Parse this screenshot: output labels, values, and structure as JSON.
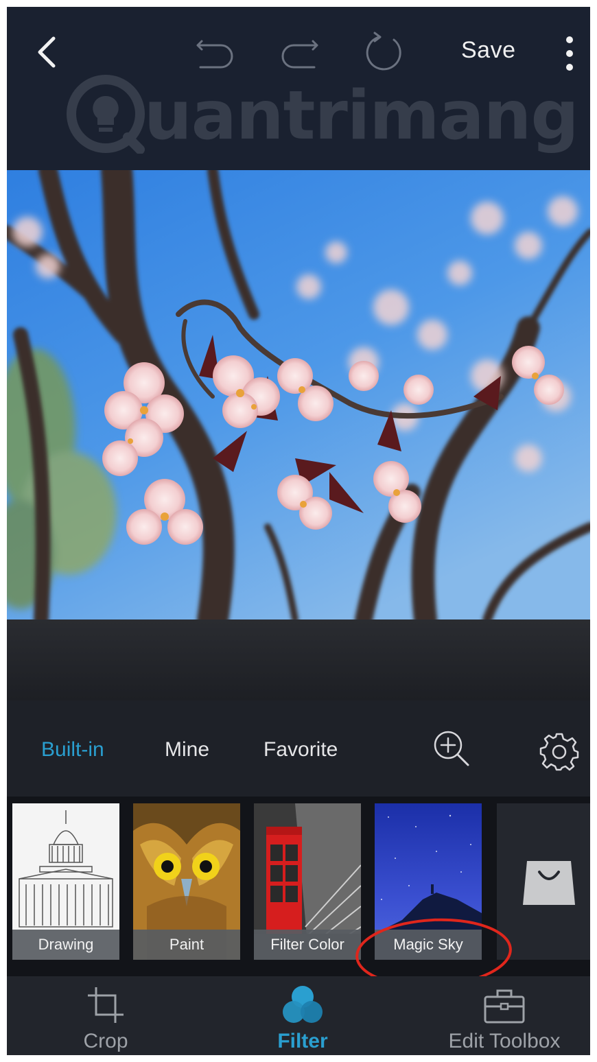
{
  "header": {
    "save_label": "Save",
    "watermark_text": "uantrimang"
  },
  "filter_tabs": [
    {
      "label": "Built-in",
      "active": true
    },
    {
      "label": "Mine",
      "active": false
    },
    {
      "label": "Favorite",
      "active": false
    }
  ],
  "filters": [
    {
      "label": "Drawing"
    },
    {
      "label": "Paint"
    },
    {
      "label": "Filter Color"
    },
    {
      "label": "Magic Sky"
    }
  ],
  "bottom_nav": [
    {
      "label": "Crop",
      "active": false
    },
    {
      "label": "Filter",
      "active": true
    },
    {
      "label": "Edit Toolbox",
      "active": false
    }
  ],
  "colors": {
    "accent": "#2a9fd0",
    "annotation": "#e0261c",
    "topbar": "#1a2130"
  },
  "icons": {
    "back": "chevron-left-icon",
    "undo": "undo-icon",
    "redo": "redo-icon",
    "reset": "rotate-icon",
    "more": "more-vertical-icon",
    "zoom": "zoom-in-icon",
    "settings": "gear-icon",
    "store": "shopping-bag-icon",
    "crop": "crop-icon",
    "filter": "filter-circles-icon",
    "toolbox": "toolbox-icon"
  }
}
